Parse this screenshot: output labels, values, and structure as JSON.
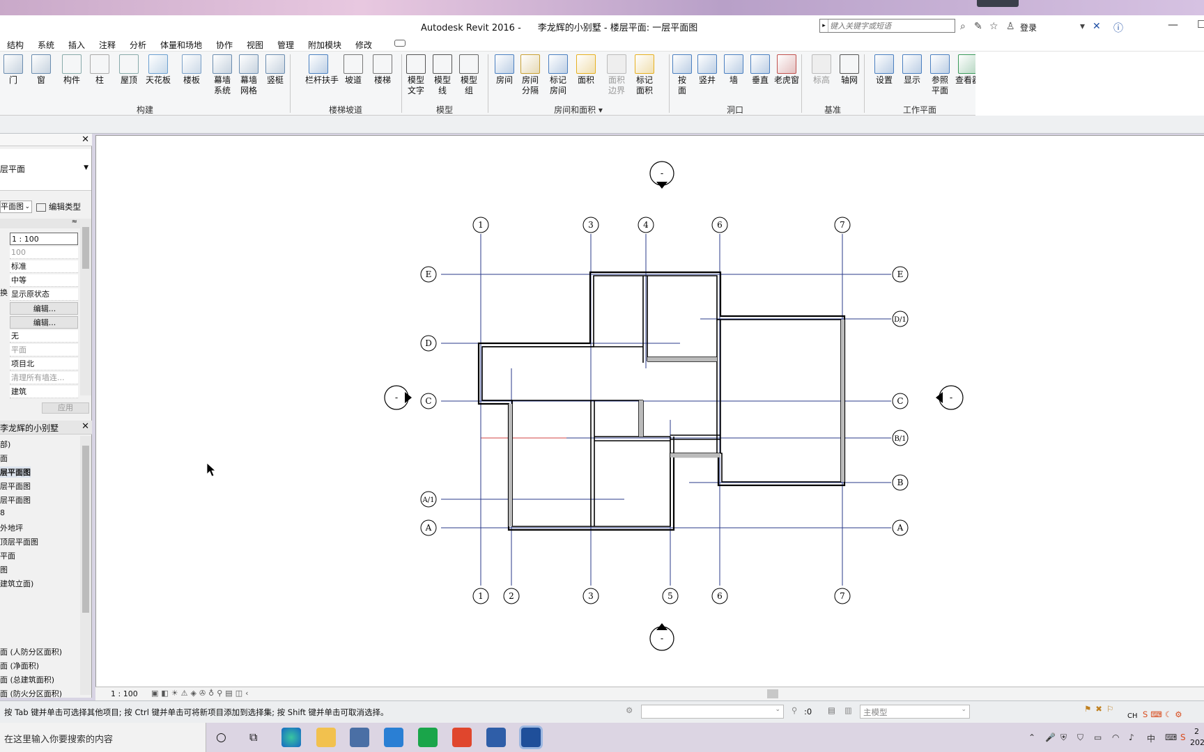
{
  "app": {
    "title": "Autodesk Revit 2016 -",
    "document": "李龙辉的小别墅 - 楼层平面: 一层平面图",
    "search_placeholder": "键入关键字或短语",
    "login": "登录"
  },
  "menu_tabs": [
    "结构",
    "系统",
    "插入",
    "注释",
    "分析",
    "体量和场地",
    "协作",
    "视图",
    "管理",
    "附加模块",
    "修改"
  ],
  "ribbon": {
    "buttons": [
      {
        "label": "门"
      },
      {
        "label": "窗"
      },
      {
        "label": "构件"
      },
      {
        "label": "柱"
      },
      {
        "label": "屋顶"
      },
      {
        "label": "天花板"
      },
      {
        "label": "楼板"
      },
      {
        "label": "幕墙\n系统"
      },
      {
        "label": "幕墙\n网格"
      },
      {
        "label": "竖梃"
      },
      {
        "label": "栏杆扶手"
      },
      {
        "label": "坡道"
      },
      {
        "label": "楼梯"
      },
      {
        "label": "模型\n文字"
      },
      {
        "label": "模型\n线"
      },
      {
        "label": "模型\n组"
      },
      {
        "label": "房间"
      },
      {
        "label": "房间\n分隔"
      },
      {
        "label": "标记\n房间"
      },
      {
        "label": "面积"
      },
      {
        "label": "面积\n边界"
      },
      {
        "label": "标记\n面积"
      },
      {
        "label": "按\n面"
      },
      {
        "label": "竖井"
      },
      {
        "label": "墙"
      },
      {
        "label": "垂直"
      },
      {
        "label": "老虎窗"
      },
      {
        "label": "标高"
      },
      {
        "label": "轴网"
      },
      {
        "label": "设置"
      },
      {
        "label": "显示"
      },
      {
        "label": "参照\n平面"
      },
      {
        "label": "查看器"
      }
    ],
    "groups": [
      "构建",
      "楼梯坡道",
      "模型",
      "房间和面积 ▾",
      "洞口",
      "基准",
      "工作平面"
    ]
  },
  "properties": {
    "type_name": "层平面",
    "view_type": "平面图",
    "edit_type": "编辑类型",
    "values": [
      "1 : 100",
      "100",
      "标准",
      "中等",
      "显示原状态",
      "编辑...",
      "编辑...",
      "无",
      "平面",
      "项目北",
      "清理所有墙连...",
      "建筑"
    ],
    "row_label": "换",
    "apply": "应用"
  },
  "browser": {
    "title": "李龙辉的小别墅",
    "items": [
      "部)",
      "面",
      "层平面图",
      "层平面图",
      "层平面图",
      "8",
      "外地坪",
      "顶层平面图",
      "平面",
      "图",
      "建筑立面)"
    ],
    "bottom_items": [
      "面 (人防分区面积)",
      "面 (净面积)",
      "面 (总建筑面积)",
      "面 (防火分区面积)"
    ]
  },
  "drawing": {
    "top_grids": [
      "1",
      "3",
      "4",
      "6",
      "7"
    ],
    "bottom_grids": [
      "1",
      "2",
      "3",
      "5",
      "6",
      "7"
    ],
    "left_grids": [
      "E",
      "D",
      "C",
      "A/1",
      "A"
    ],
    "right_grids": [
      "E",
      "D/1",
      "C",
      "B/1",
      "B",
      "A"
    ],
    "elevation_mark": "-"
  },
  "view_bar": {
    "scale": "1 : 100"
  },
  "status": {
    "hint": "按 Tab 键并单击可选择其他项目; 按 Ctrl 键并单击可将新项目添加到选择集; 按 Shift 键并单击可取消选择。",
    "counter": ":0",
    "model": "主模型"
  },
  "taskbar": {
    "search": "在这里输入你要搜索的内容",
    "ime": "CH",
    "lang": "中",
    "clock_top": "2",
    "clock_bottom": "202"
  }
}
